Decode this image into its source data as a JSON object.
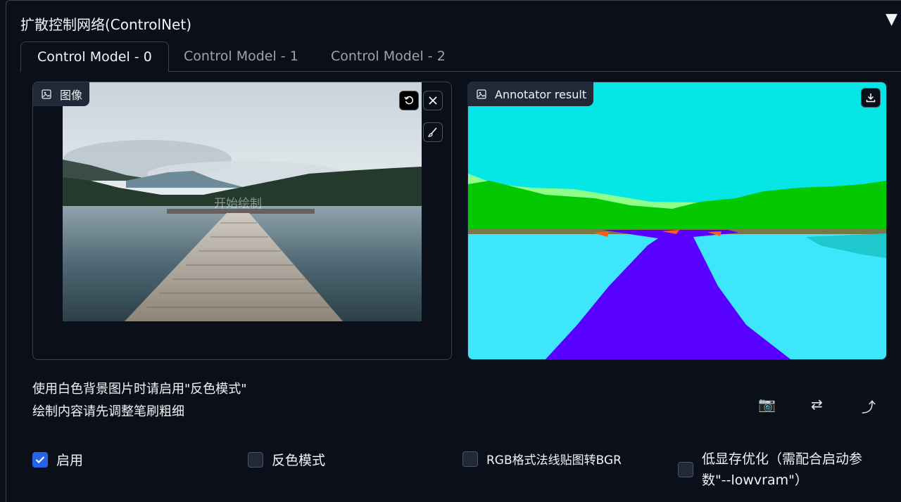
{
  "accordion": {
    "title": "扩散控制网络(ControlNet)",
    "toggle_glyph": "▼"
  },
  "tabs": [
    "Control Model - 0",
    "Control Model - 1",
    "Control Model - 2"
  ],
  "active_tab": 0,
  "image_input": {
    "label": "图像",
    "watermark": "开始绘制"
  },
  "annotator": {
    "label": "Annotator result"
  },
  "hints": {
    "line1": "使用白色背景图片时请启用\"反色模式\"",
    "line2": "绘制内容请先调整笔刷粗细"
  },
  "tools": {
    "camera": "📷",
    "swap": "⇄",
    "send": "⤴"
  },
  "checkboxes": {
    "enable": {
      "label": "启用",
      "checked": true
    },
    "invert": {
      "label": "反色模式",
      "checked": false
    },
    "rgb_bgr": {
      "label": "RGB格式法线贴图转BGR",
      "checked": false
    },
    "lowvram": {
      "label": "低显存优化（需配合启动参数\"--lowvram\"）",
      "checked": false
    }
  },
  "colors": {
    "background": "#0b0f19",
    "accent": "#2563eb",
    "seg_sky": "#06e6e6",
    "seg_water": "#3de6fa",
    "seg_pier": "#5800ff",
    "seg_trees": "#04c800",
    "seg_mountain": "#8fff8c"
  }
}
